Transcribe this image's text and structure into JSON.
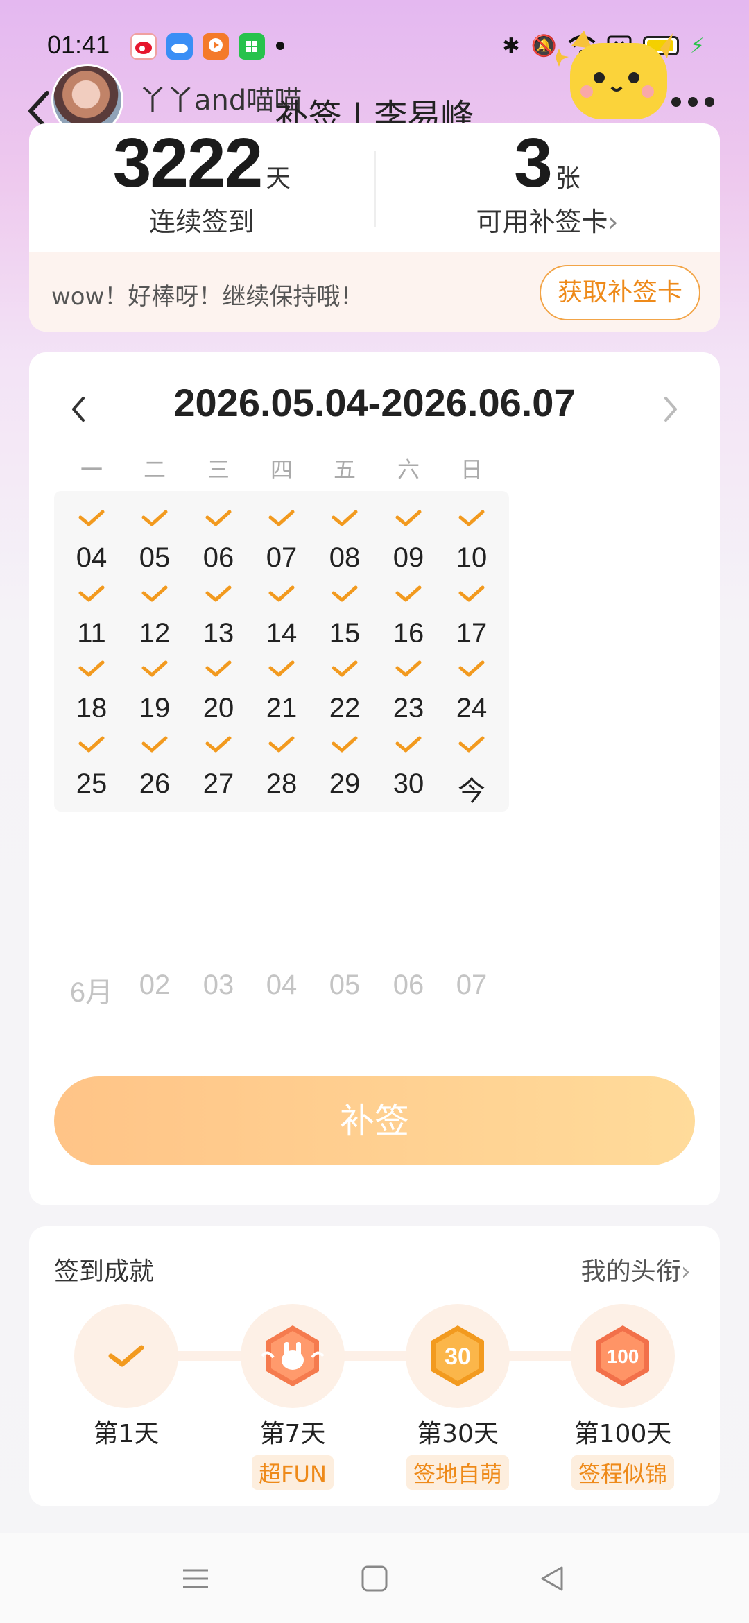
{
  "status": {
    "time": "01:41"
  },
  "header": {
    "username": "丫丫and喵喵",
    "title": "补签 | 李易峰"
  },
  "stats": {
    "streak_value": "3222",
    "streak_unit": "天",
    "streak_label": "连续签到",
    "cards_value": "3",
    "cards_unit": "张",
    "cards_label": "可用补签卡",
    "cards_chevron": "›",
    "message": "wow！好棒呀！继续保持哦！",
    "get_card_button": "获取补签卡"
  },
  "calendar": {
    "range": "2026.05.04-2026.06.07",
    "weekdays": [
      "一",
      "二",
      "三",
      "四",
      "五",
      "六",
      "日"
    ],
    "signed_days": [
      "04",
      "05",
      "06",
      "07",
      "08",
      "09",
      "10",
      "11",
      "12",
      "13",
      "14",
      "15",
      "16",
      "17",
      "18",
      "19",
      "20",
      "21",
      "22",
      "23",
      "24",
      "25",
      "26",
      "27",
      "28",
      "29",
      "30",
      "今"
    ],
    "future_days": [
      "6月",
      "02",
      "03",
      "04",
      "05",
      "06",
      "07"
    ],
    "makeup_button": "补签",
    "accent_color": "#f29a1f"
  },
  "achievements": {
    "title": "签到成就",
    "my_titles_link": "我的头衔",
    "my_titles_chevron": "›",
    "items": [
      {
        "day": "第1天",
        "tag": "",
        "icon": "check-icon"
      },
      {
        "day": "第7天",
        "tag": "超FUN",
        "icon": "hand-badge-icon"
      },
      {
        "day": "第30天",
        "tag": "签地自萌",
        "icon": "30-days-badge-icon"
      },
      {
        "day": "第100天",
        "tag": "签程似锦",
        "icon": "100-days-badge-icon"
      }
    ],
    "badge_30_text": "30",
    "badge_100_text": "100"
  }
}
